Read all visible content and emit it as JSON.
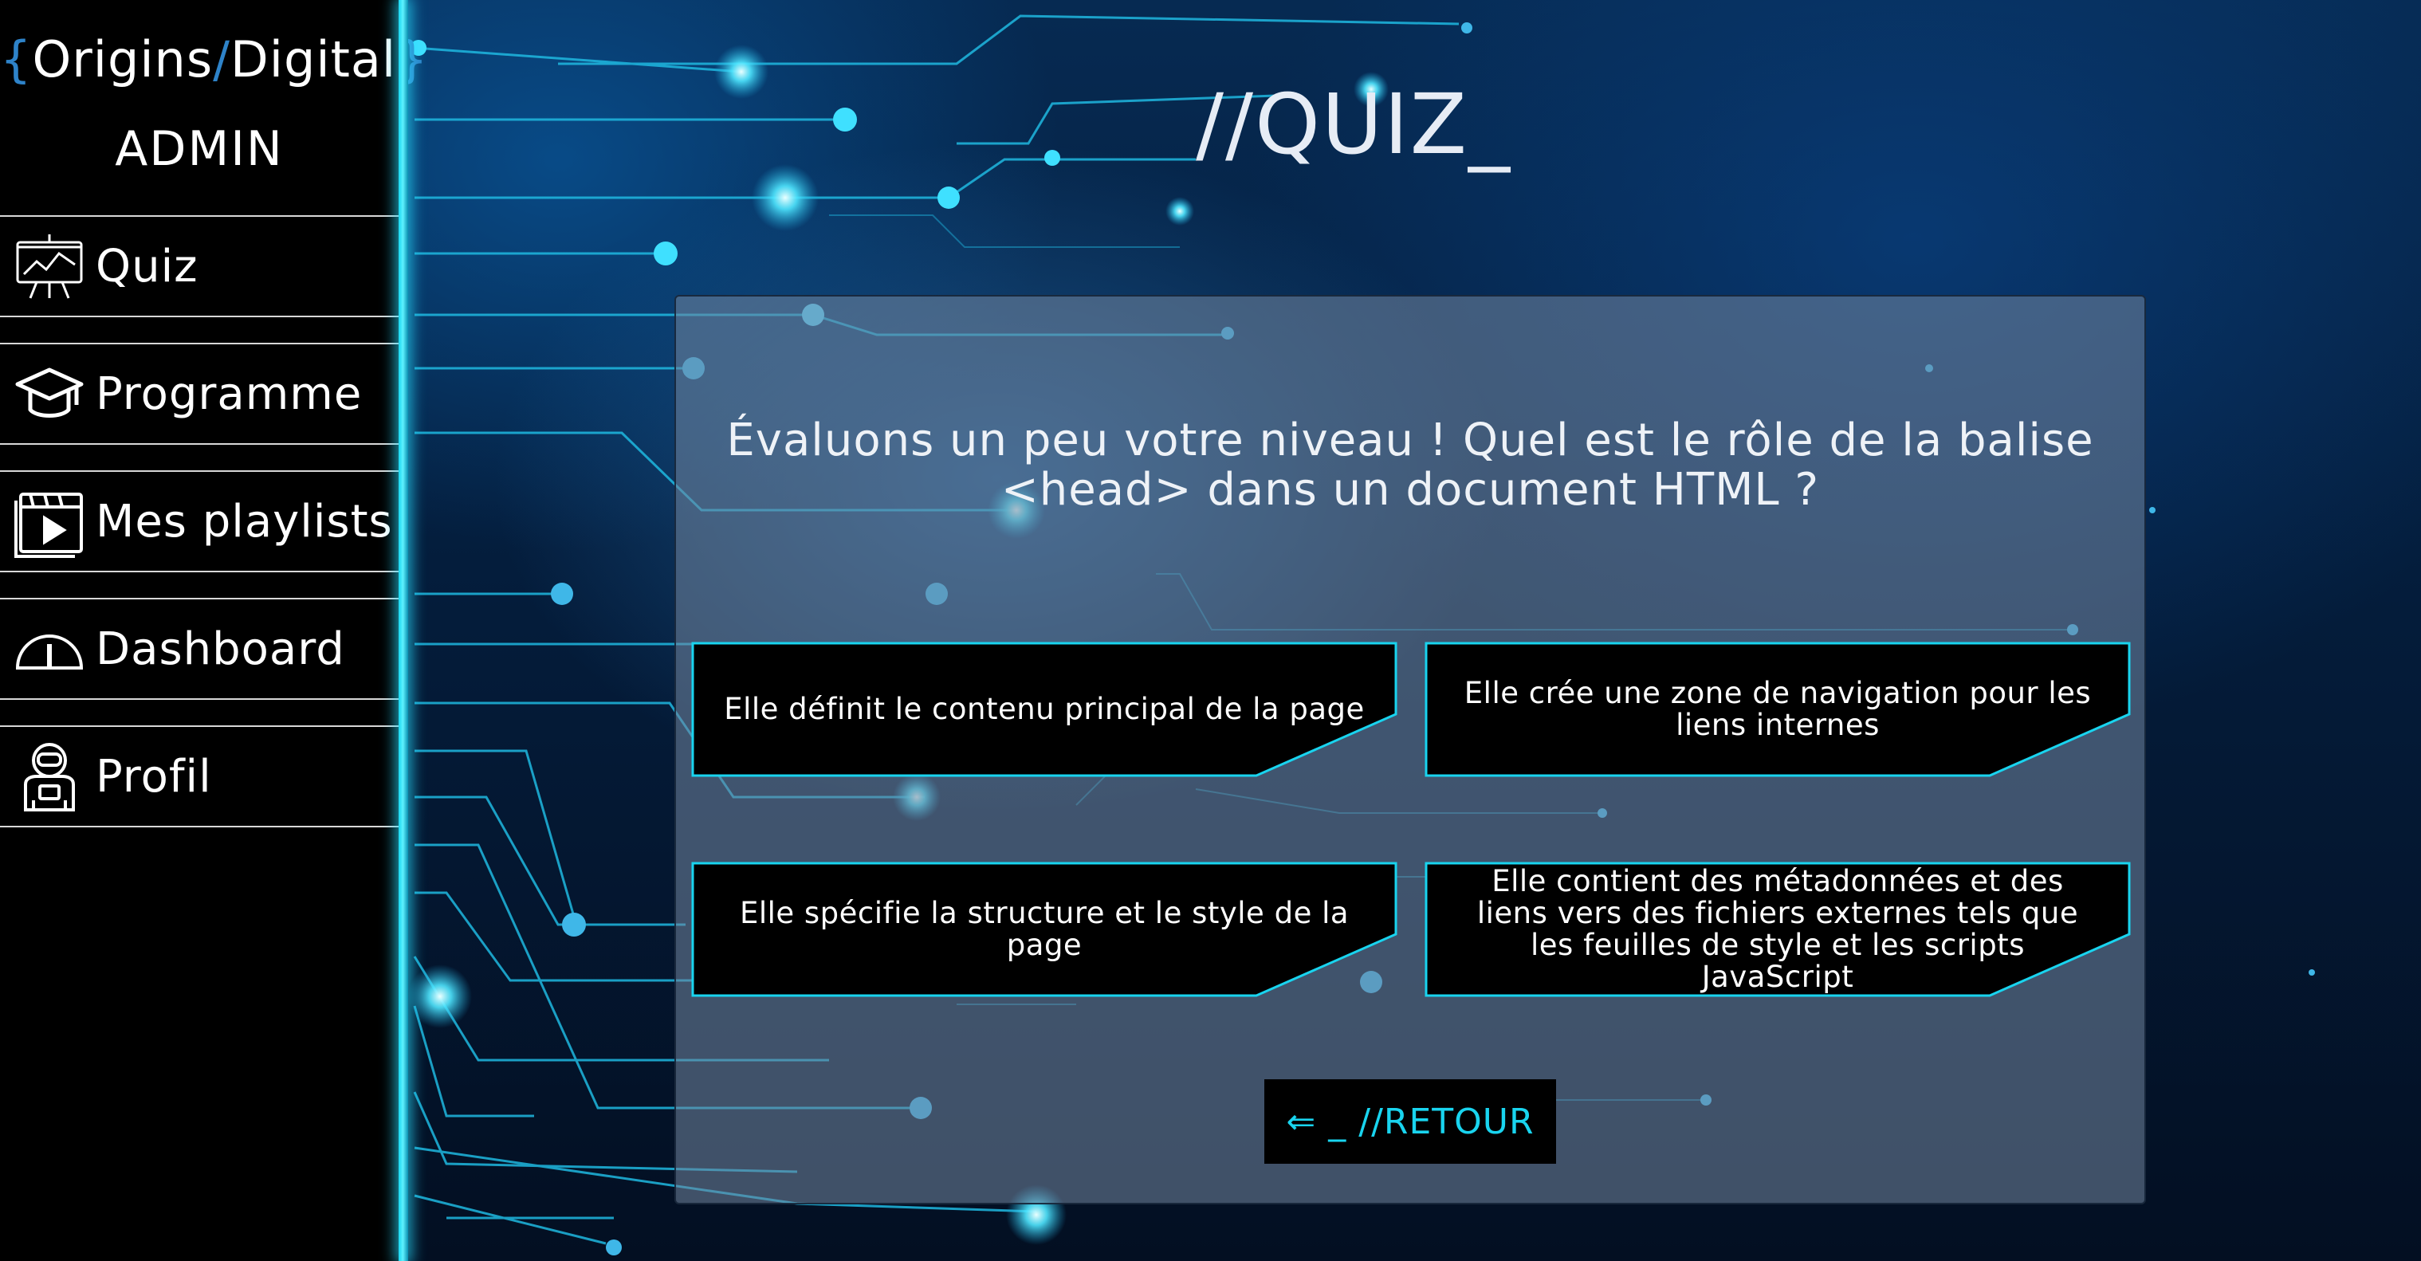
{
  "sidebar": {
    "brand": {
      "open": "{",
      "left": "Origins",
      "slash": "/",
      "right": "Digital",
      "close": "}"
    },
    "role": "ADMIN",
    "items": [
      {
        "label": "Quiz",
        "icon": "presentation-chart-icon"
      },
      {
        "label": "Programme",
        "icon": "graduation-cap-icon"
      },
      {
        "label": "Mes playlists",
        "icon": "video-playlist-icon"
      },
      {
        "label": "Dashboard",
        "icon": "gauge-icon"
      },
      {
        "label": "Profil",
        "icon": "astronaut-icon"
      }
    ]
  },
  "main": {
    "title": "//QUIZ_",
    "question": "Évaluons un peu votre niveau ! Quel est le rôle de la balise <head> dans un document HTML ?",
    "answers": [
      "Elle définit le contenu principal de la page",
      "Elle crée une zone de navigation pour les liens internes",
      "Elle spécifie la structure et le style de la page",
      "Elle contient des métadonnées et des liens vers des fichiers externes tels que les feuilles de style et les scripts JavaScript"
    ],
    "back_label": "⇐ _ //RETOUR"
  },
  "colors": {
    "accent": "#19d4ef",
    "sidebar_bg": "#000000",
    "card_bg": "#73879f",
    "brand_brace": "#2e83c9"
  }
}
